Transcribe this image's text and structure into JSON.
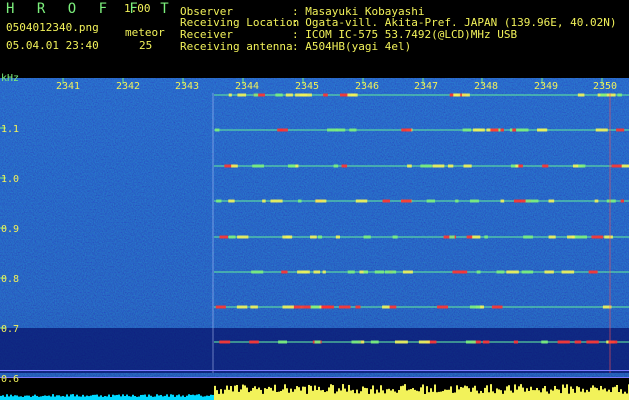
{
  "app": {
    "title": "H R O F F T",
    "version": "1.00"
  },
  "file": {
    "name": "0504012340.png",
    "datetime": "05.04.01 23:40"
  },
  "meteor": {
    "label": "meteor",
    "count": "25"
  },
  "info": [
    {
      "label": "Observer",
      "value": ": Masayuki Kobayashi"
    },
    {
      "label": "Receiving Location",
      "value": ": Ogata-vill. Akita-Pref. JAPAN (139.96E, 40.02N)"
    },
    {
      "label": "Receiver",
      "value": ": ICOM IC-575 53.7492(@LCD)MHz USB"
    },
    {
      "label": "Receiving antenna",
      "value": ": A504HB(yagi 4el)"
    }
  ],
  "axis": {
    "unit": "kHz",
    "y_ticks": [
      "1.1",
      "1.0",
      "0.9",
      "0.8",
      "0.7",
      "0.6"
    ],
    "x_ticks": [
      "2341",
      "2342",
      "2343",
      "2344",
      "2345",
      "2346",
      "2347",
      "2348",
      "2349",
      "2350"
    ]
  },
  "colors": {
    "label_green": "#7cf07c",
    "value_yellow": "#f2f25a",
    "background_blue": "#0a1a9a",
    "signal_red": "#ff3030",
    "level_bar_cyan": "#00d8ff"
  }
}
